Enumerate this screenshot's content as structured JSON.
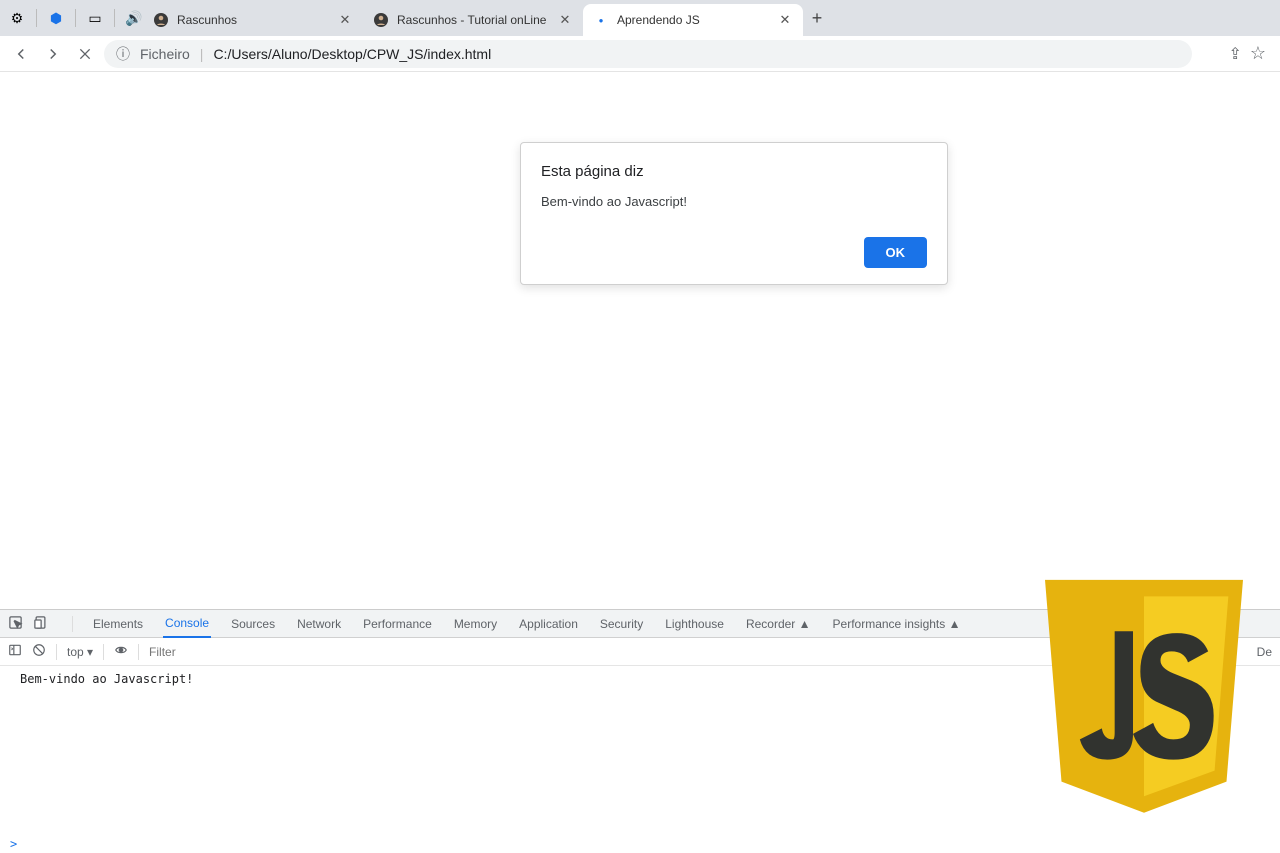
{
  "tabs": [
    {
      "title": "Rascunhos",
      "favicon": "portrait"
    },
    {
      "title": "Rascunhos - Tutorial onLine",
      "favicon": "portrait"
    },
    {
      "title": "Aprendendo JS",
      "favicon": "dot",
      "active": true
    }
  ],
  "address": {
    "scheme_label": "Ficheiro",
    "path": "C:/Users/Aluno/Desktop/CPW_JS/index.html"
  },
  "dialog": {
    "title": "Esta página diz",
    "message": "Bem-vindo ao Javascript!",
    "ok": "OK"
  },
  "devtools": {
    "panels": [
      "Elements",
      "Console",
      "Sources",
      "Network",
      "Performance",
      "Memory",
      "Application",
      "Security",
      "Lighthouse",
      "Recorder ▲",
      "Performance insights ▲"
    ],
    "active_panel": "Console",
    "context": "top ▾",
    "filter_placeholder": "Filter",
    "right_label": "De",
    "log": "Bem-vindo ao Javascript!",
    "prompt": ">"
  }
}
